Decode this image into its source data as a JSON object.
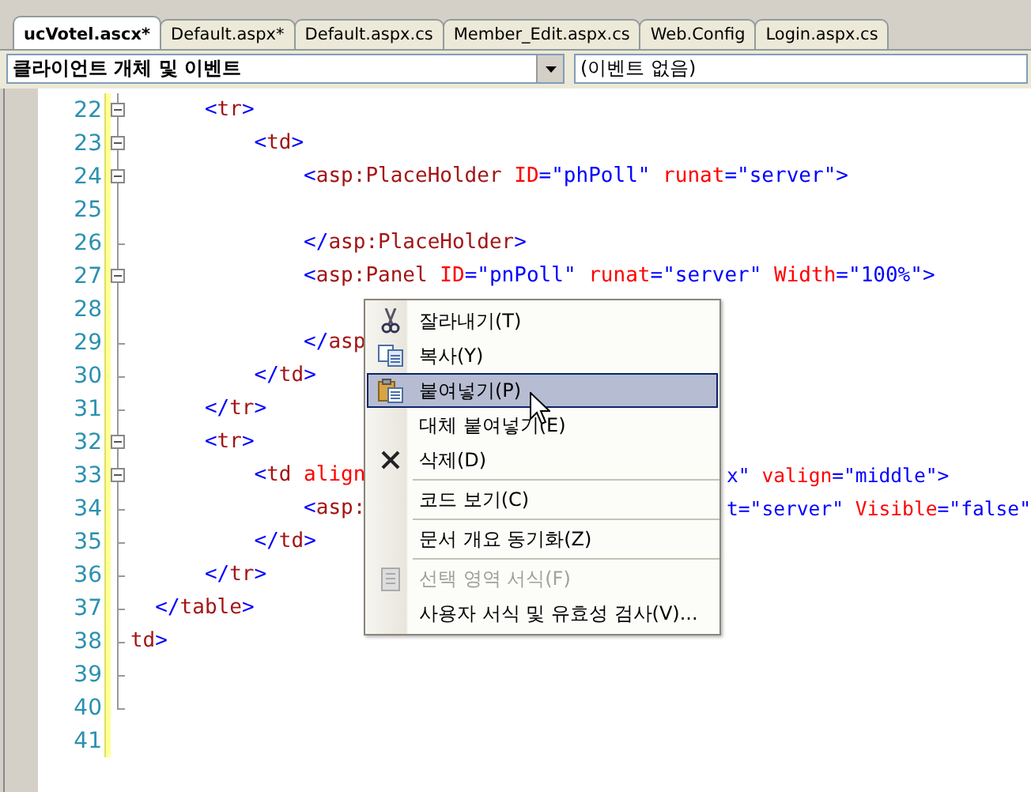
{
  "tabs": [
    {
      "label": "ucVotel.ascx*",
      "selected": true
    },
    {
      "label": "Default.aspx*",
      "selected": false
    },
    {
      "label": "Default.aspx.cs",
      "selected": false
    },
    {
      "label": "Member_Edit.aspx.cs",
      "selected": false
    },
    {
      "label": "Web.Config",
      "selected": false
    },
    {
      "label": "Login.aspx.cs",
      "selected": false
    }
  ],
  "object_dropdown": {
    "value": "클라이언트 개체 및 이벤트"
  },
  "event_dropdown": {
    "value": "(이벤트 없음)"
  },
  "code_lines": [
    {
      "number": "22",
      "collapsible": true,
      "tokens": [
        {
          "kind": "bracket",
          "text": "      <"
        },
        {
          "kind": "tag",
          "text": "tr"
        },
        {
          "kind": "bracket",
          "text": ">"
        }
      ]
    },
    {
      "number": "23",
      "collapsible": true,
      "tokens": [
        {
          "kind": "bracket",
          "text": "          <"
        },
        {
          "kind": "tag",
          "text": "td"
        },
        {
          "kind": "bracket",
          "text": ">"
        }
      ]
    },
    {
      "number": "24",
      "collapsible": true,
      "tokens": [
        {
          "kind": "bracket",
          "text": "              <"
        },
        {
          "kind": "tag",
          "text": "asp:PlaceHolder"
        },
        {
          "kind": "attr",
          "text": " ID"
        },
        {
          "kind": "bracket",
          "text": "=\"phPoll\""
        },
        {
          "kind": "attr",
          "text": " runat"
        },
        {
          "kind": "bracket",
          "text": "=\"server\">"
        }
      ]
    },
    {
      "number": "25",
      "collapsible": false
    },
    {
      "number": "26",
      "collapsible": false,
      "tokens": [
        {
          "kind": "bracket",
          "text": "              </"
        },
        {
          "kind": "tag",
          "text": "asp:PlaceHolder"
        },
        {
          "kind": "bracket",
          "text": ">"
        }
      ]
    },
    {
      "number": "27",
      "collapsible": true,
      "tokens": [
        {
          "kind": "bracket",
          "text": "              <"
        },
        {
          "kind": "tag",
          "text": "asp:Panel"
        },
        {
          "kind": "attr",
          "text": " ID"
        },
        {
          "kind": "bracket",
          "text": "=\"pnPoll\""
        },
        {
          "kind": "attr",
          "text": " runat"
        },
        {
          "kind": "bracket",
          "text": "=\"server\""
        },
        {
          "kind": "attr",
          "text": " Width"
        },
        {
          "kind": "bracket",
          "text": "=\"100%\">"
        }
      ]
    },
    {
      "number": "28",
      "collapsible": false
    },
    {
      "number": "29",
      "collapsible": false,
      "tokens": [
        {
          "kind": "bracket",
          "text": "              </"
        },
        {
          "kind": "tag",
          "text": "asp"
        }
      ]
    },
    {
      "number": "30",
      "collapsible": false,
      "tokens": [
        {
          "kind": "bracket",
          "text": "          </"
        },
        {
          "kind": "tag",
          "text": "td"
        },
        {
          "kind": "bracket",
          "text": ">"
        }
      ]
    },
    {
      "number": "31",
      "collapsible": false,
      "tokens": [
        {
          "kind": "bracket",
          "text": "      </"
        },
        {
          "kind": "tag",
          "text": "tr"
        },
        {
          "kind": "bracket",
          "text": ">"
        }
      ]
    },
    {
      "number": "32",
      "collapsible": true,
      "tokens": [
        {
          "kind": "bracket",
          "text": "      <"
        },
        {
          "kind": "tag",
          "text": "tr"
        },
        {
          "kind": "bracket",
          "text": ">"
        }
      ]
    },
    {
      "number": "33",
      "collapsible": true,
      "tokens": [
        {
          "kind": "bracket",
          "text": "          <"
        },
        {
          "kind": "tag",
          "text": "td"
        },
        {
          "kind": "attr",
          "text": " align"
        }
      ],
      "tail": [
        {
          "kind": "bracket",
          "text": "x\""
        },
        {
          "kind": "attr",
          "text": " valign"
        },
        {
          "kind": "bracket",
          "text": "=\"middle\">"
        }
      ]
    },
    {
      "number": "34",
      "collapsible": false,
      "tokens": [
        {
          "kind": "bracket",
          "text": "              <"
        },
        {
          "kind": "tag",
          "text": "asp:"
        }
      ],
      "tail": [
        {
          "kind": "bracket",
          "text": "t=\"server\""
        },
        {
          "kind": "attr",
          "text": " Visible"
        },
        {
          "kind": "bracket",
          "text": "=\"false\""
        }
      ]
    },
    {
      "number": "35",
      "collapsible": false,
      "tokens": [
        {
          "kind": "bracket",
          "text": "          </"
        },
        {
          "kind": "tag",
          "text": "td"
        },
        {
          "kind": "bracket",
          "text": ">"
        }
      ]
    },
    {
      "number": "36",
      "collapsible": false,
      "tokens": [
        {
          "kind": "bracket",
          "text": "      </"
        },
        {
          "kind": "tag",
          "text": "tr"
        },
        {
          "kind": "bracket",
          "text": ">"
        }
      ]
    },
    {
      "number": "37",
      "collapsible": false,
      "tokens": [
        {
          "kind": "bracket",
          "text": "  </"
        },
        {
          "kind": "tag",
          "text": "table"
        },
        {
          "kind": "bracket",
          "text": ">"
        }
      ]
    },
    {
      "number": "38",
      "collapsible": false,
      "tokens": [
        {
          "kind": "tag",
          "text": "td"
        },
        {
          "kind": "bracket",
          "text": ">"
        }
      ]
    },
    {
      "number": "39",
      "collapsible": false
    },
    {
      "number": "40",
      "collapsible": false
    },
    {
      "number": "41",
      "collapsible": false
    }
  ],
  "context_menu": {
    "items": [
      {
        "kind": "item",
        "label": "잘라내기(T)",
        "selected": false,
        "disabled": false
      },
      {
        "kind": "item",
        "label": "복사(Y)",
        "selected": false,
        "disabled": false
      },
      {
        "kind": "item",
        "label": "붙여넣기(P)",
        "selected": true,
        "disabled": false
      },
      {
        "kind": "item",
        "label": "대체 붙여넣기(E)",
        "selected": false,
        "disabled": false
      },
      {
        "kind": "item",
        "label": "삭제(D)",
        "selected": false,
        "disabled": false
      },
      {
        "kind": "separator"
      },
      {
        "kind": "item",
        "label": "코드 보기(C)",
        "selected": false,
        "disabled": false
      },
      {
        "kind": "separator"
      },
      {
        "kind": "item",
        "label": "문서 개요 동기화(Z)",
        "selected": false,
        "disabled": false
      },
      {
        "kind": "separator"
      },
      {
        "kind": "item",
        "label": "선택 영역 서식(F)",
        "selected": false,
        "disabled": true
      },
      {
        "kind": "item",
        "label": "사용자 서식 및 유효성 검사(V)...",
        "selected": false,
        "disabled": false
      }
    ]
  }
}
